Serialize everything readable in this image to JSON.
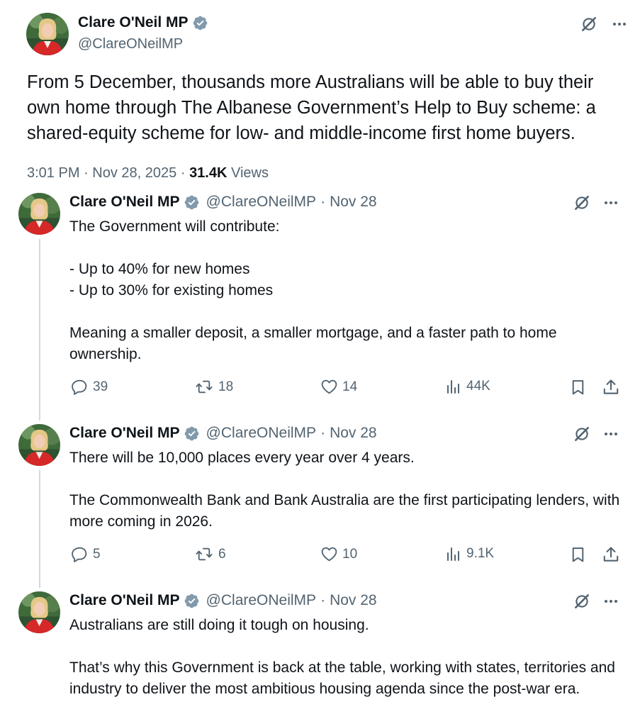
{
  "main": {
    "author_name": "Clare O'Neil MP",
    "handle": "@ClareONeilMP",
    "text": "From 5 December, thousands more Australians will be able to buy their own home through The Albanese Government’s Help to Buy scheme: a shared-equity scheme for low- and middle-income first home buyers.",
    "time": "3:01 PM",
    "date": "Nov 28, 2025",
    "views_count": "31.4K",
    "views_label": "Views"
  },
  "replies": [
    {
      "author_name": "Clare O'Neil MP",
      "handle": "@ClareONeilMP",
      "date": "Nov 28",
      "text": "The Government will contribute:\n\n- Up to 40% for new homes\n- Up to 30% for existing homes\n\nMeaning a smaller deposit, a smaller mortgage, and a faster path to home ownership.",
      "replies": "39",
      "reposts": "18",
      "likes": "14",
      "views": "44K"
    },
    {
      "author_name": "Clare O'Neil MP",
      "handle": "@ClareONeilMP",
      "date": "Nov 28",
      "text": "There will be 10,000 places every year over 4 years.\n\nThe Commonwealth Bank and Bank Australia are the first participating lenders, with more coming in 2026.",
      "replies": "5",
      "reposts": "6",
      "likes": "10",
      "views": "9.1K"
    },
    {
      "author_name": "Clare O'Neil MP",
      "handle": "@ClareONeilMP",
      "date": "Nov 28",
      "text": "Australians are still doing it tough on housing.\n\nThat’s why this Government is back at the table, working with states, territories and industry to deliver the most ambitious housing agenda since the post-war era."
    }
  ],
  "separators": {
    "dot": "·"
  },
  "icons": [
    "verified-badge-icon",
    "grok-icon",
    "more-icon",
    "reply-icon",
    "repost-icon",
    "like-icon",
    "views-icon",
    "bookmark-icon",
    "share-icon"
  ],
  "colors": {
    "verified": "#829aab",
    "muted": "#536471",
    "text": "#0f1419",
    "thread_line": "#cfd9de"
  }
}
